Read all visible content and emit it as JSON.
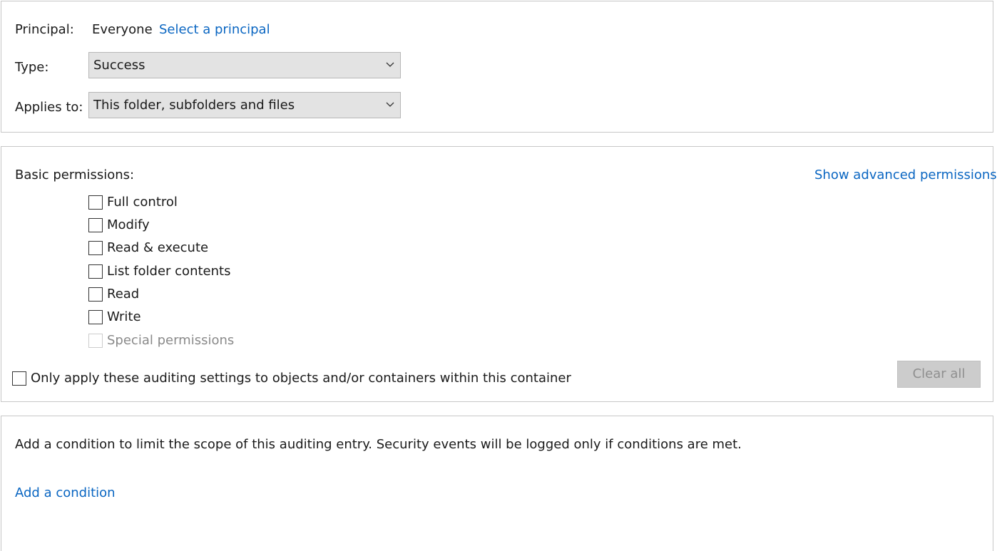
{
  "principal": {
    "label": "Principal:",
    "value": "Everyone",
    "select_link": "Select a principal"
  },
  "type": {
    "label": "Type:",
    "value": "Success"
  },
  "applies_to": {
    "label": "Applies to:",
    "value": "This folder, subfolders and files"
  },
  "permissions": {
    "label": "Basic permissions:",
    "advanced_link": "Show advanced permissions",
    "items": [
      {
        "label": "Full control",
        "checked": false,
        "disabled": false
      },
      {
        "label": "Modify",
        "checked": false,
        "disabled": false
      },
      {
        "label": "Read & execute",
        "checked": false,
        "disabled": false
      },
      {
        "label": "List folder contents",
        "checked": false,
        "disabled": false
      },
      {
        "label": "Read",
        "checked": false,
        "disabled": false
      },
      {
        "label": "Write",
        "checked": false,
        "disabled": false
      },
      {
        "label": "Special permissions",
        "checked": false,
        "disabled": true
      }
    ],
    "only_apply_label": "Only apply these auditing settings to objects and/or containers within this container",
    "clear_all_label": "Clear all"
  },
  "condition": {
    "description": "Add a condition to limit the scope of this auditing entry. Security events will be logged only if conditions are met.",
    "add_link": "Add a condition"
  }
}
